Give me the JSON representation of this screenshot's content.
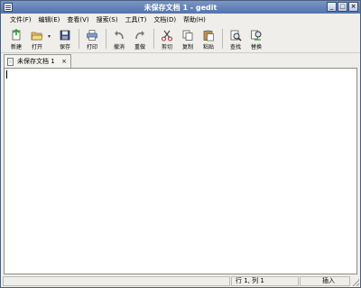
{
  "window": {
    "title": "未保存文档 1 - gedit"
  },
  "window_buttons": {
    "minimize": "_",
    "maximize": "□",
    "close": "×"
  },
  "menubar": [
    "文件(F)",
    "编辑(E)",
    "查看(V)",
    "搜索(S)",
    "工具(T)",
    "文档(D)",
    "帮助(H)"
  ],
  "toolbar": {
    "new": "新建",
    "open": "打开",
    "save": "保存",
    "print": "打印",
    "undo": "撤消",
    "redo": "重做",
    "cut": "剪切",
    "copy": "复制",
    "paste": "粘贴",
    "find": "查找",
    "replace": "替换"
  },
  "tab": {
    "label": "未保存文档 1",
    "close": "×"
  },
  "editor": {
    "content": ""
  },
  "statusbar": {
    "position": "行 1, 列 1",
    "mode": "插入"
  },
  "colors": {
    "titlebar": "#5a78b0",
    "accent": "#324a78"
  }
}
